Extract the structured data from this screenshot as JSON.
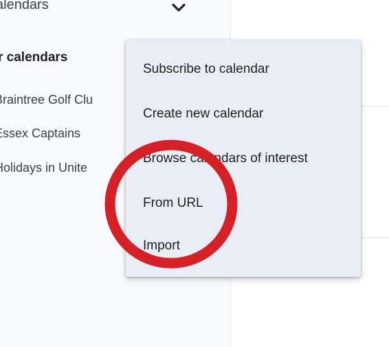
{
  "sidebar": {
    "section_header": "alendars",
    "chevron_icon": "chevron-down-icon",
    "group_title": "r calendars",
    "calendars": [
      {
        "label": "Braintree Golf Clu"
      },
      {
        "label": "Essex Captains"
      },
      {
        "label": "Holidays in Unite"
      }
    ]
  },
  "menu": {
    "items": [
      {
        "label": "Subscribe to calendar"
      },
      {
        "label": "Create new calendar"
      },
      {
        "label": "Browse calendars of interest"
      },
      {
        "label": "From URL"
      },
      {
        "label": "Import"
      }
    ]
  },
  "annotation": {
    "shape": "circle",
    "color": "#d71f26"
  }
}
